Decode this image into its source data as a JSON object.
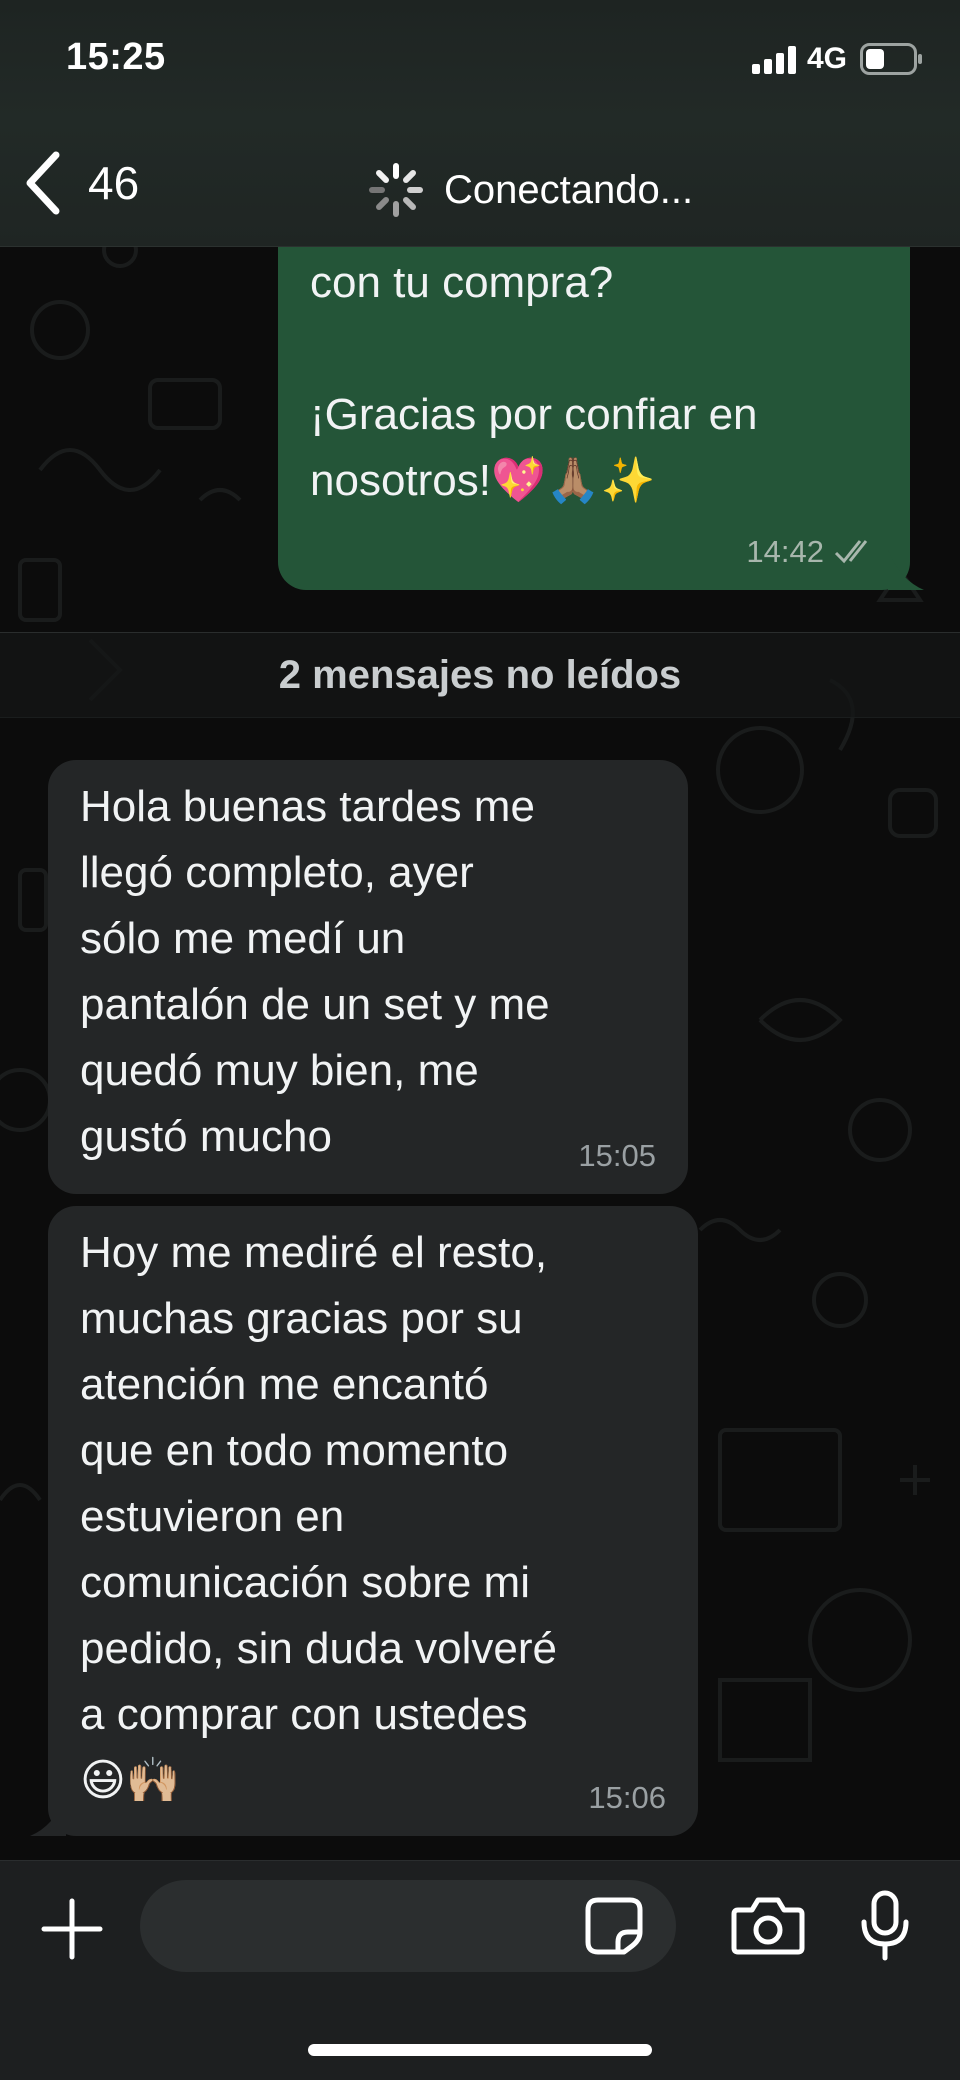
{
  "status_bar": {
    "time": "15:25",
    "network": "4G"
  },
  "header": {
    "back_count": "46",
    "connection_status": "Conectando..."
  },
  "messages": [
    {
      "direction": "outgoing",
      "lines": [
        "con tu compra?",
        "",
        "¡Gracias por confiar en",
        "nosotros!💖🙏🏽✨"
      ],
      "time": "14:42",
      "read_receipt": "double-check"
    },
    {
      "direction": "incoming",
      "lines": [
        "Hola buenas tardes me",
        "llegó completo, ayer",
        "sólo me medí un",
        "pantalón de un set y me",
        "quedó muy bien, me",
        "gustó mucho"
      ],
      "time": "15:05"
    },
    {
      "direction": "incoming",
      "lines": [
        "Hoy me mediré el resto,",
        "muchas gracias por su",
        "atención me encantó",
        "que en todo momento",
        "estuvieron en",
        "comunicación sobre mi",
        "pedido, sin duda volveré",
        "a comprar con ustedes",
        "😃🙌🏼"
      ],
      "time": "15:06"
    }
  ],
  "unread_divider": "2 mensajes no leídos",
  "composer": {
    "value": "",
    "placeholder": ""
  },
  "icons": {
    "back": "chevron-left-icon",
    "spinner": "spinner-icon",
    "plus": "plus-icon",
    "sticker": "sticker-icon",
    "camera": "camera-icon",
    "mic": "microphone-icon"
  },
  "colors": {
    "outgoing_bubble": "#245538",
    "incoming_bubble": "#242627",
    "background": "#0c0c0c"
  }
}
